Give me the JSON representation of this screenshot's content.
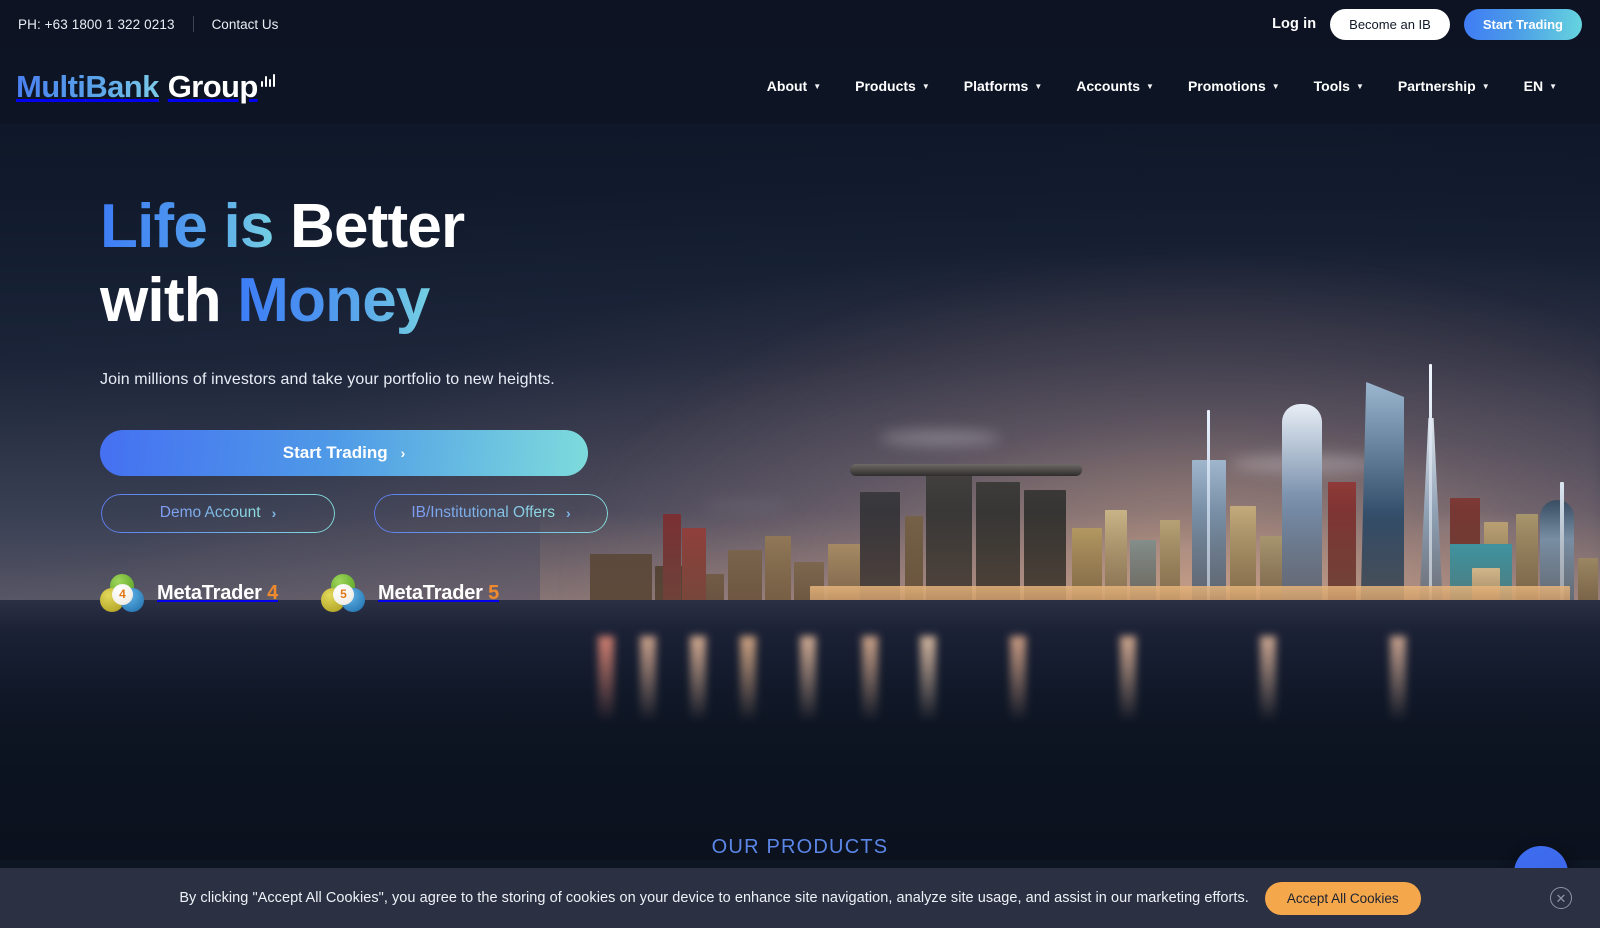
{
  "topbar": {
    "phone": "PH: +63 1800 1 322 0213",
    "contact_label": "Contact Us",
    "login_label": "Log in",
    "become_ib_label": "Become an IB",
    "start_trading_label": "Start Trading"
  },
  "brand": {
    "name_part1": "Multi",
    "name_part2": "Bank",
    "name_part3": "Group"
  },
  "nav": {
    "items": [
      {
        "label": "About",
        "caret": "▼"
      },
      {
        "label": "Products",
        "caret": "▼"
      },
      {
        "label": "Platforms",
        "caret": "▼"
      },
      {
        "label": "Accounts",
        "caret": "▼"
      },
      {
        "label": "Promotions",
        "caret": "▼"
      },
      {
        "label": "Tools",
        "caret": "▼"
      },
      {
        "label": "Partnership",
        "caret": "▼"
      },
      {
        "label": "EN",
        "caret": "▼"
      }
    ]
  },
  "hero": {
    "headline_line1_a": "Life is",
    "headline_line1_b": "Better",
    "headline_line2_a": "with",
    "headline_line2_b": "Money",
    "subhead": "Join millions of investors and take your portfolio to new heights.",
    "cta_primary": "Start Trading",
    "cta_chevron": "›",
    "cta_demo": "Demo Account",
    "cta_ib": "IB/Institutional Offers",
    "platforms": [
      {
        "name": "MetaTrader",
        "number": "4",
        "badge": "4"
      },
      {
        "name": "MetaTrader",
        "number": "5",
        "badge": "5"
      }
    ]
  },
  "section": {
    "our_products_label": "OUR PRODUCTS"
  },
  "cookie": {
    "message": "By clicking \"Accept All Cookies\", you agree to the storing of cookies on your device to enhance site navigation, analyze site usage, and assist in our marketing efforts.",
    "accept_label": "Accept All Cookies",
    "close_glyph": "✕"
  },
  "colors": {
    "accent_blue": "#3d7df7",
    "accent_cyan": "#74cfe2",
    "cookie_orange": "#f5a74b",
    "products_heading": "#5b86e8",
    "background_navy": "#0d1524"
  }
}
